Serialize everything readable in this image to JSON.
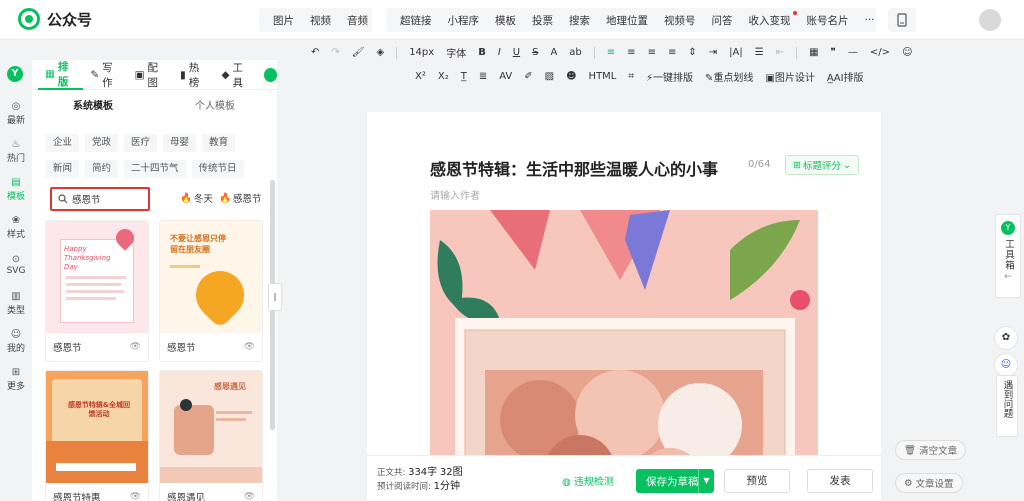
{
  "app": {
    "name": "公众号"
  },
  "topnav": {
    "group1": [
      "图片",
      "视频",
      "音频"
    ],
    "group2": [
      "超链接",
      "小程序",
      "模板",
      "投票",
      "搜索",
      "地理位置",
      "视频号",
      "问答",
      "收入变现",
      "账号名片",
      "···"
    ]
  },
  "rail": [
    {
      "icon": "◎",
      "label": "最新"
    },
    {
      "icon": "♨",
      "label": "热门"
    },
    {
      "icon": "▤",
      "label": "模板"
    },
    {
      "icon": "❀",
      "label": "样式"
    },
    {
      "icon": "⊙",
      "label": "SVG"
    },
    {
      "icon": "▥",
      "label": "类型"
    },
    {
      "icon": "☺",
      "label": "我的"
    },
    {
      "icon": "⊞",
      "label": "更多"
    }
  ],
  "panel": {
    "tabs": [
      "排版",
      "写作",
      "配图",
      "热榜",
      "工具"
    ],
    "subtabs": [
      "系统模板",
      "个人模板"
    ],
    "chips_row1": [
      "企业",
      "党政",
      "医疗",
      "母婴",
      "教育"
    ],
    "chips_row2": [
      "新闻",
      "简约",
      "二十四节气",
      "传统节日"
    ],
    "search_value": "感恩节",
    "hot_tags": [
      "冬天",
      "感恩节"
    ],
    "cards": [
      {
        "label": "感恩节",
        "thumb_title": "Happy Thanksgiving Day"
      },
      {
        "label": "感恩节",
        "thumb_title": "不要让感恩只停留在朋友圈"
      },
      {
        "label": "感恩节特惠",
        "thumb_title": "感恩节特辑&全城回馈活动"
      },
      {
        "label": "感恩遇见",
        "thumb_title": "感恩遇见"
      }
    ]
  },
  "toolbar": {
    "font_size": "14px",
    "font_label": "字体",
    "one_key": "一键排版",
    "highlight": "重点划线",
    "image_design": "图片设计",
    "ai_layout": "AI排版"
  },
  "editor": {
    "title": "感恩节特辑：生活中那些温暖人心的小事",
    "title_count": "0/64",
    "score_label": "标题评分",
    "author_placeholder": "请输入作者"
  },
  "bottom": {
    "body_label": "正文共:",
    "word_count": "334字",
    "image_count": "32图",
    "read_label": "预计阅读时间:",
    "read_time": "1分钟",
    "check_label": "违规检测",
    "save_label": "保存为草稿",
    "preview_label": "预览",
    "publish_label": "发表"
  },
  "right": {
    "toolbox_label": "工具箱",
    "problems_label": "遇到问题",
    "clear_label": "清空文章",
    "settings_label": "文章设置"
  },
  "colors": {
    "accent": "#07c160",
    "highlight_border": "#e3342f"
  }
}
